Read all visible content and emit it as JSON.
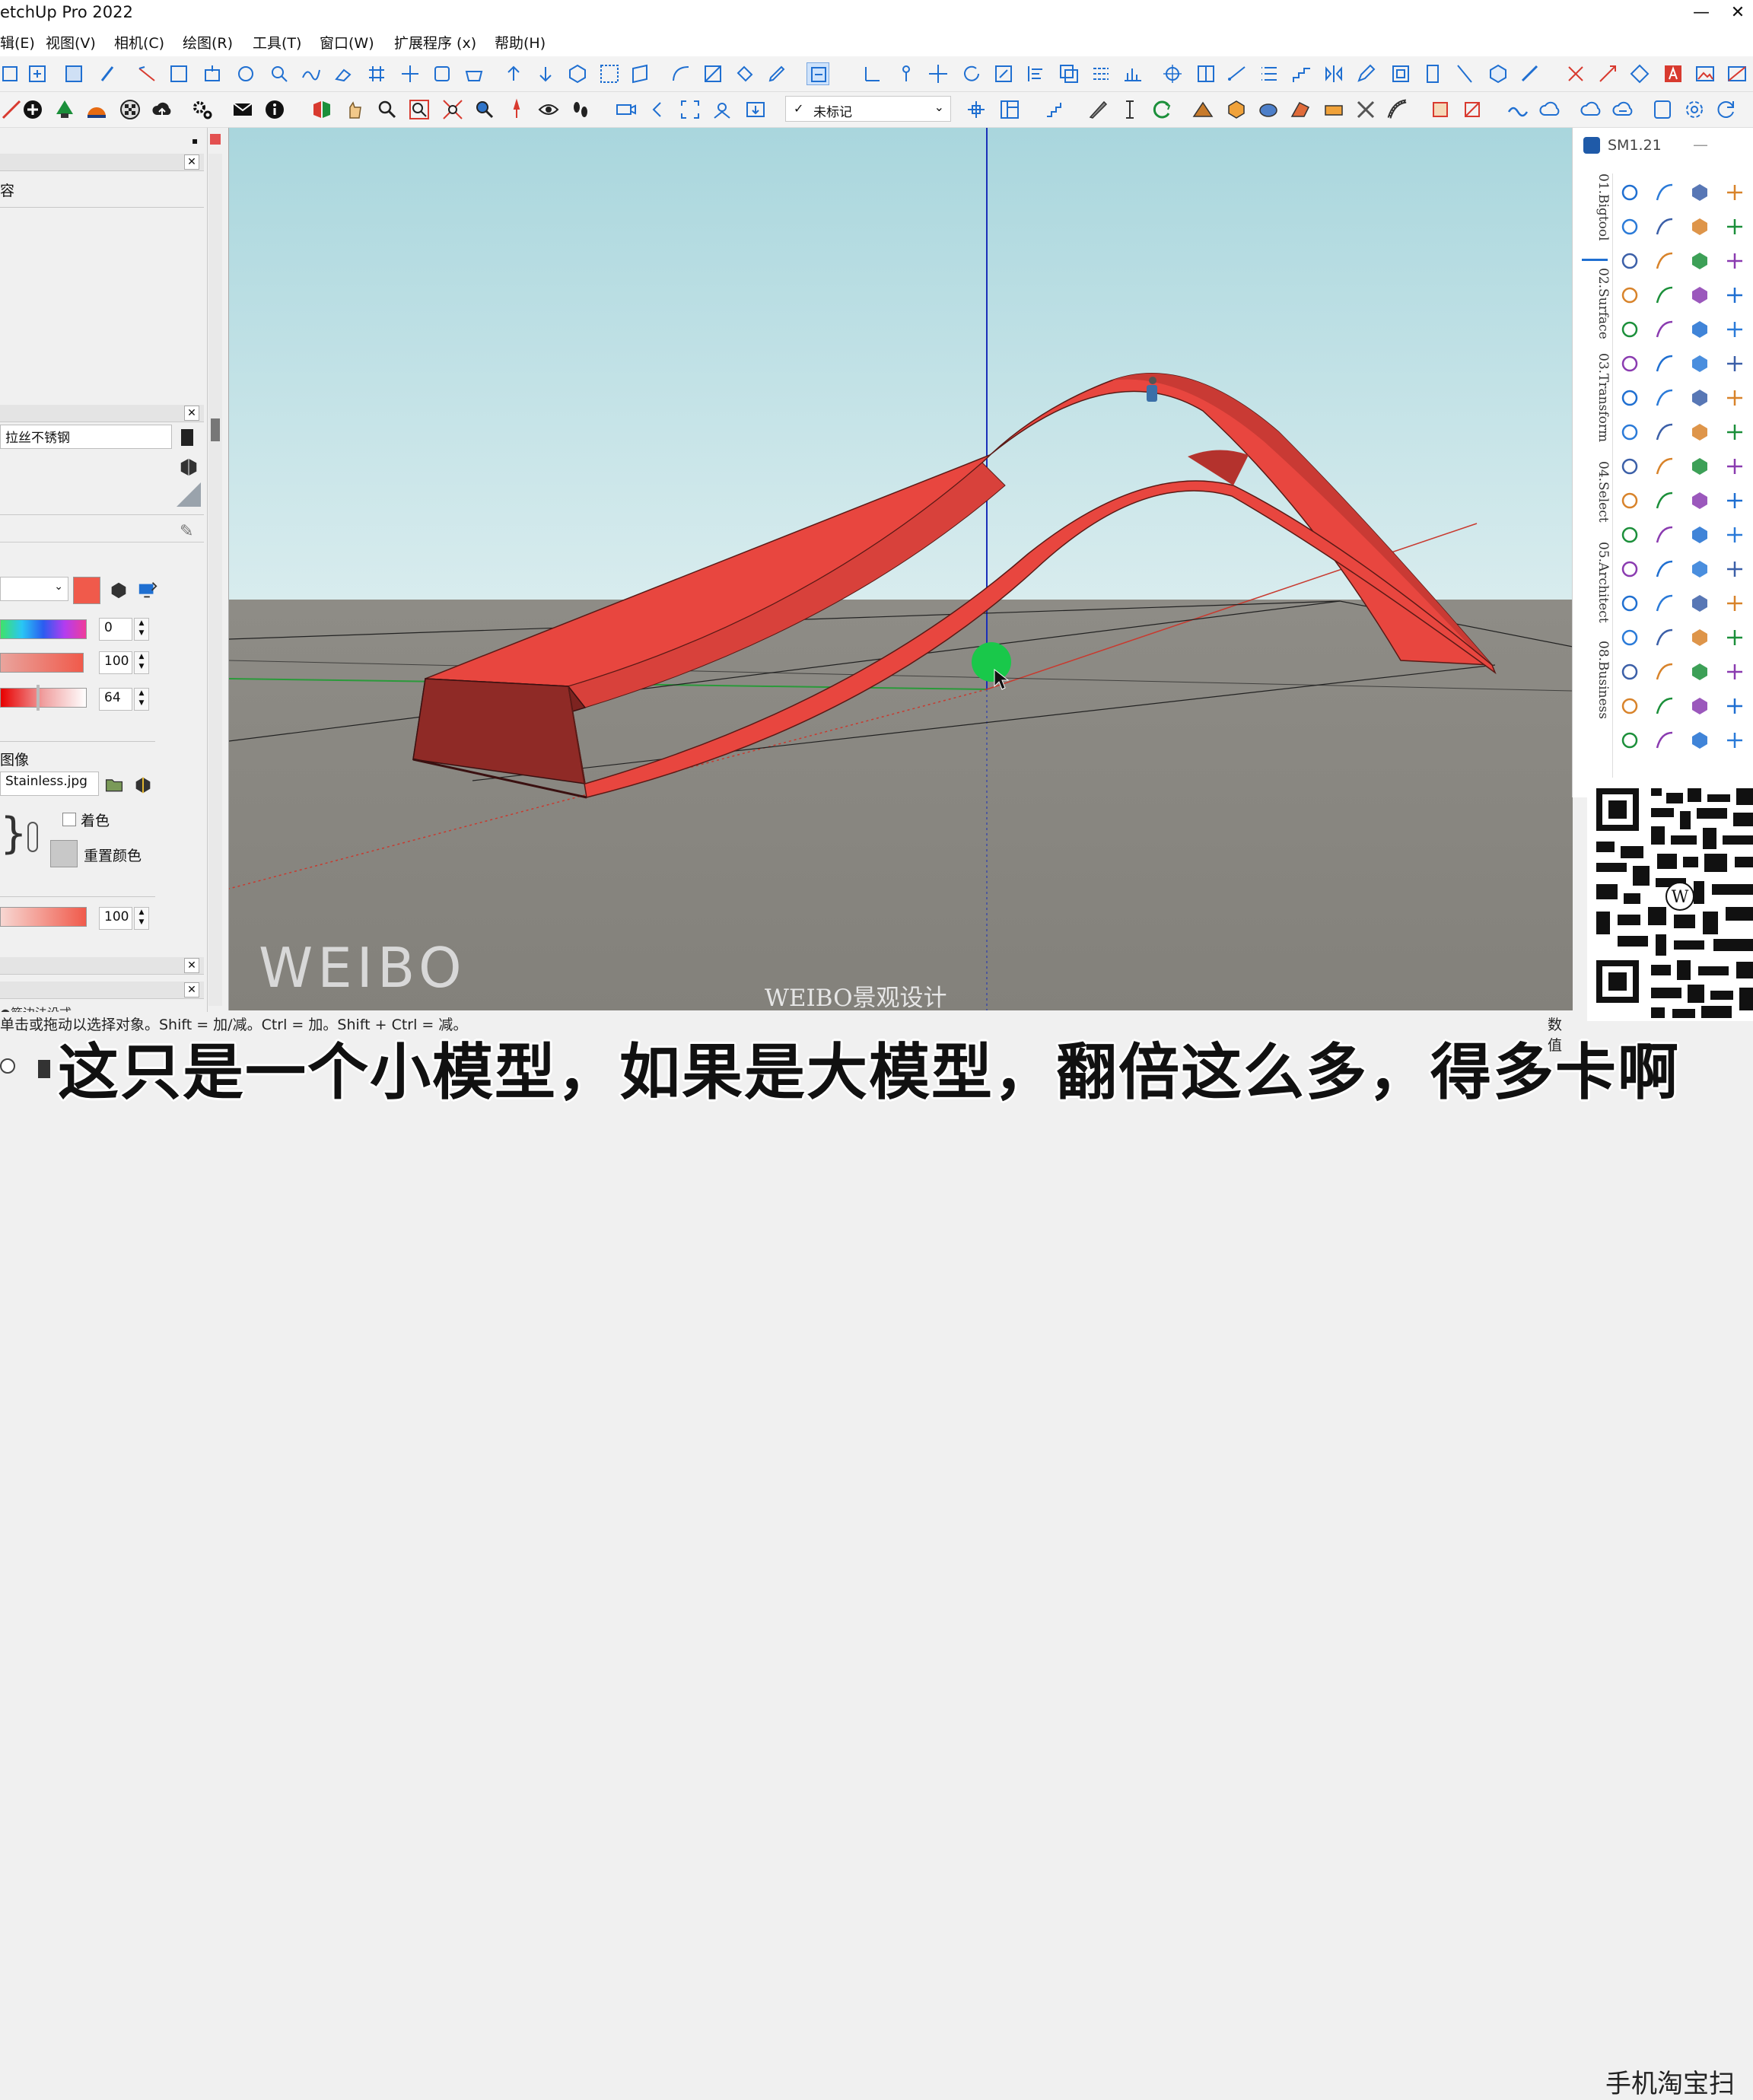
{
  "window": {
    "title": "etchUp Pro 2022",
    "min_glyph": "—",
    "close_glyph": "✕"
  },
  "menu": [
    "辑(E)",
    "视图(V)",
    "相机(C)",
    "绘图(R)",
    "工具(T)",
    "窗口(W)",
    "扩展程序 (x)",
    "帮助(H)"
  ],
  "tag_select": {
    "check": "✓",
    "value": "未标记",
    "arrow": "⌄"
  },
  "left_panel": {
    "contents_label": "容",
    "material_name": "拉丝不锈钢",
    "value_hue": "0",
    "value_sat": "100",
    "value_light": "64",
    "texture_heading": "图像",
    "texture_file": "Stainless.jpg",
    "colorize_label": "着色",
    "reset_color_label": "重置颜色",
    "opacity_value": "100",
    "bottom_label": "●筋边法设式"
  },
  "right_panel": {
    "title": "SM1.21",
    "tabs": [
      "01.Bigtool",
      "02.Surface",
      "03.Transform",
      "04.Select",
      "05.Architect",
      "08.Business"
    ]
  },
  "status_bar": {
    "hint": "单击或拖动以选择对象。Shift = 加/减。Ctrl = 加。Shift + Ctrl = 减。",
    "right": "数值"
  },
  "subtitle": "这只是一个小模型，如果是大模型，翻倍这么多，得多卡啊",
  "side_caption": "手机淘宝扫",
  "watermarks": {
    "brand": "WEIBO",
    "studio": "WEIBO景观设计"
  },
  "colors": {
    "sky": "#bde0e6",
    "ground": "#8a8883",
    "model_red": "#e8463f",
    "cursor_green": "#19c84a"
  }
}
